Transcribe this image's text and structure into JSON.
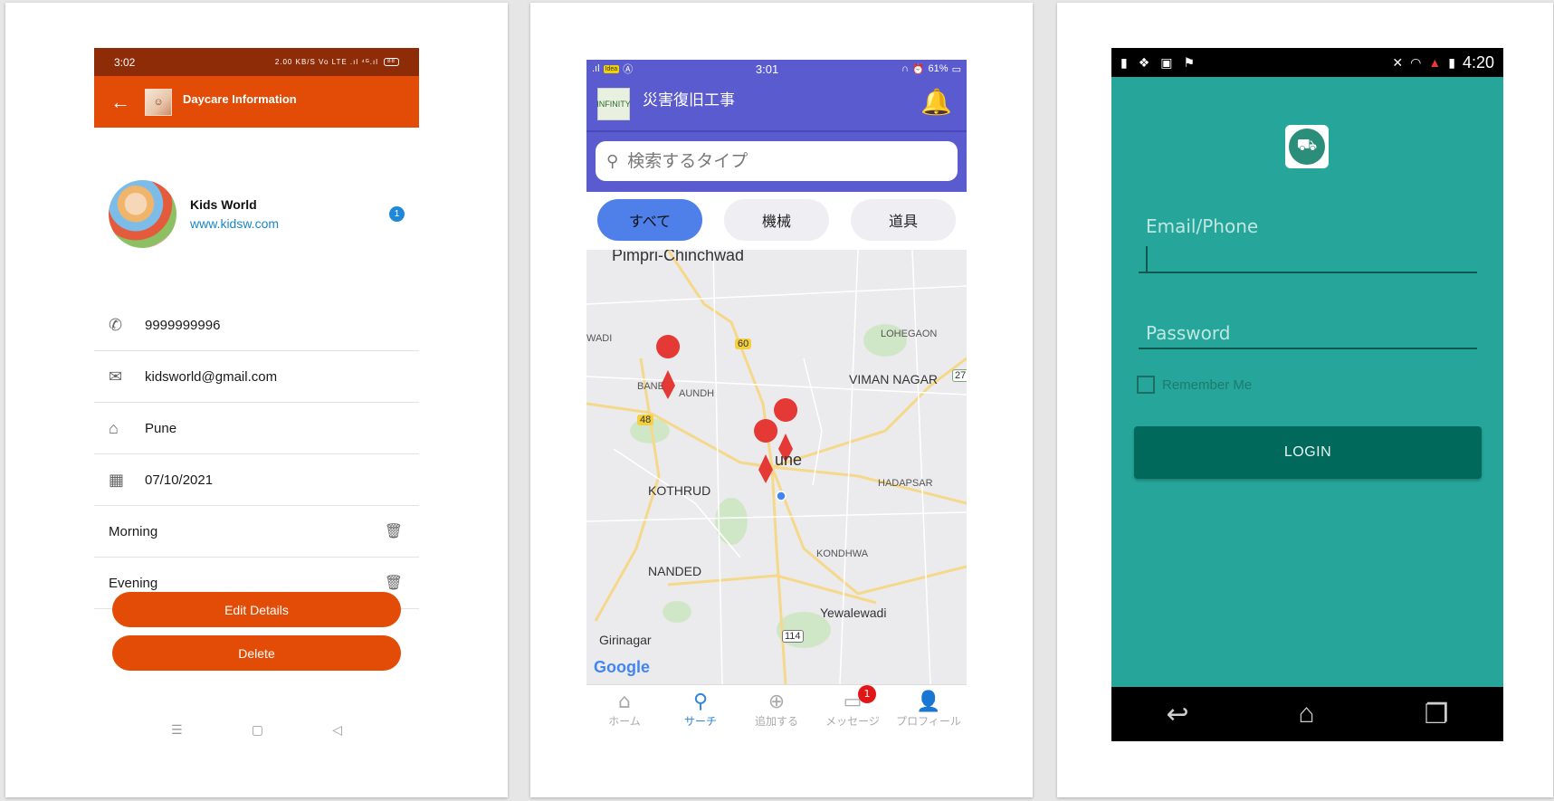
{
  "phone1": {
    "status": {
      "time": "3:02",
      "indicators": "2.00 KB/S Vo LTE .ıl ⁴ᴳ.ıl",
      "battery": "88"
    },
    "appbar": {
      "back_icon": "arrow-back-icon",
      "title": "Daycare Information"
    },
    "profile": {
      "name": "Kids World",
      "url": "www.kidsw.com",
      "badge": "1"
    },
    "contact_rows": [
      {
        "icon": "phone-icon",
        "value": "9999999996"
      },
      {
        "icon": "mail-icon",
        "value": "kidsworld@gmail.com"
      },
      {
        "icon": "home-icon",
        "value": "Pune"
      },
      {
        "icon": "calendar-icon",
        "value": "07/10/2021"
      }
    ],
    "time_slots": [
      "Morning",
      "Evening"
    ],
    "buttons": {
      "edit": "Edit Details",
      "delete": "Delete"
    },
    "accent": "#e34c06"
  },
  "phone2": {
    "status": {
      "time": "3:01",
      "battery": "61%"
    },
    "appbar": {
      "logo_text": "INFINITY",
      "title": "災害復旧工事"
    },
    "search": {
      "placeholder": "検索するタイプ"
    },
    "chips": [
      "すべて",
      "機械",
      "道具"
    ],
    "map": {
      "labels": [
        "Pimpri-Chinchwad",
        "WADI",
        "BANE",
        "AUNDH",
        "LOHEGAON",
        "VIMAN NAGAR",
        "KOTHRUD",
        "HADAPSAR",
        "KONDHWA",
        "NANDED",
        "Yewalewadi",
        "Girinagar",
        "une"
      ],
      "road_badges": [
        "60",
        "48",
        "27",
        "114"
      ],
      "attribution": "Google"
    },
    "tabs": [
      "ホーム",
      "サーチ",
      "追加する",
      "メッセージ",
      "プロフィール"
    ],
    "message_badge": "1",
    "accent": "#5b5bd0"
  },
  "phone3": {
    "status": {
      "time": "4:20"
    },
    "fields": {
      "email_label": "Email/Phone",
      "password_label": "Password"
    },
    "remember_label": "Remember Me",
    "login_label": "LOGIN",
    "accent": "#26a69a"
  }
}
